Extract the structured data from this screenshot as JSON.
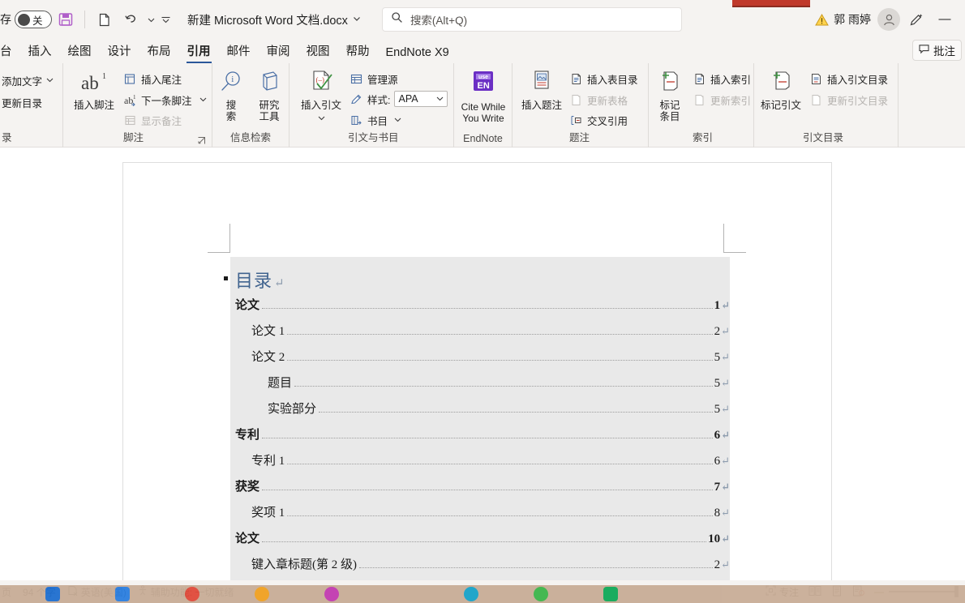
{
  "titlebar": {
    "autosave_label": "存",
    "toggle_state": "关",
    "save_icon": "save-icon",
    "new_icon": "new-document-icon",
    "undo_icon": "undo-icon",
    "customize_icon": "customize-quick-access-icon",
    "document_title": "新建 Microsoft Word 文档.docx",
    "title_chevron": "chevron-down-icon",
    "search_icon": "search-icon",
    "search_placeholder": "搜索(Alt+Q)",
    "warning_icon": "warning-icon",
    "user_name": "郭 雨婷",
    "avatar_icon": "account-avatar-icon",
    "pen_icon": "pen-annotate-icon",
    "minimize_label": "—"
  },
  "tabs": {
    "items": [
      {
        "label": "台",
        "active": false
      },
      {
        "label": "插入",
        "active": false
      },
      {
        "label": "绘图",
        "active": false
      },
      {
        "label": "设计",
        "active": false
      },
      {
        "label": "布局",
        "active": false
      },
      {
        "label": "引用",
        "active": true
      },
      {
        "label": "邮件",
        "active": false
      },
      {
        "label": "审阅",
        "active": false
      },
      {
        "label": "视图",
        "active": false
      },
      {
        "label": "帮助",
        "active": false
      },
      {
        "label": "EndNote X9",
        "active": false
      }
    ],
    "comments_label": "批注",
    "comments_icon": "comment-icon"
  },
  "ribbon": {
    "groups": [
      {
        "name": "toc",
        "label": "录",
        "items": [
          {
            "label": "添加文字",
            "icon": "add-text-icon",
            "chevron": true,
            "disabled": false
          },
          {
            "label": "更新目录",
            "icon": "update-toc-icon",
            "chevron": false,
            "disabled": false
          }
        ]
      },
      {
        "name": "footnotes",
        "label": "脚注",
        "big": {
          "label": "插入脚注",
          "icon": "ab-footnote-icon"
        },
        "items": [
          {
            "label": "插入尾注",
            "icon": "insert-endnote-icon",
            "chevron": false,
            "disabled": false
          },
          {
            "label": "下一条脚注",
            "icon": "next-footnote-icon",
            "chevron": true,
            "disabled": false
          },
          {
            "label": "显示备注",
            "icon": "show-notes-icon",
            "chevron": false,
            "disabled": true
          }
        ],
        "launcher": "dialog-launcher-icon"
      },
      {
        "name": "research",
        "label": "信息检索",
        "buttons": [
          {
            "label": "搜\n索",
            "line1": "搜",
            "line2": "索",
            "icon": "search-magnifier-icon"
          },
          {
            "label": "研究\n工具",
            "line1": "研究",
            "line2": "工具",
            "icon": "researcher-icon"
          }
        ]
      },
      {
        "name": "citations",
        "label": "引文与书目",
        "big": {
          "label": "插入引文",
          "icon": "insert-citation-icon",
          "chevron": true
        },
        "items": [
          {
            "label": "管理源",
            "icon": "manage-sources-icon",
            "chevron": false,
            "disabled": false
          },
          {
            "label": "样式:",
            "icon": "style-icon",
            "combo": "APA",
            "combo_chevron": "chevron-down-icon",
            "disabled": false
          },
          {
            "label": "书目",
            "icon": "bibliography-icon",
            "chevron": true,
            "disabled": false
          }
        ]
      },
      {
        "name": "endnote",
        "label": "EndNote",
        "big": {
          "line1": "Cite While",
          "line2": "You Write",
          "icon": "endnote-cwyw-icon",
          "icon_text_top": "use",
          "icon_text_bottom": "EN"
        }
      },
      {
        "name": "captions",
        "label": "题注",
        "big": {
          "label": "插入题注",
          "icon": "insert-caption-icon"
        },
        "items": [
          {
            "label": "插入表目录",
            "icon": "insert-table-of-figures-icon",
            "chevron": false,
            "disabled": false
          },
          {
            "label": "更新表格",
            "icon": "update-table-icon",
            "chevron": false,
            "disabled": true
          },
          {
            "label": "交叉引用",
            "icon": "cross-reference-icon",
            "chevron": false,
            "disabled": false
          }
        ]
      },
      {
        "name": "index",
        "label": "索引",
        "big": {
          "line1": "标记",
          "line2": "条目",
          "icon": "mark-entry-icon"
        },
        "items": [
          {
            "label": "插入索引",
            "icon": "insert-index-icon",
            "chevron": false,
            "disabled": false
          },
          {
            "label": "更新索引",
            "icon": "update-index-icon",
            "chevron": false,
            "disabled": true
          }
        ]
      },
      {
        "name": "authorities",
        "label": "引文目录",
        "big": {
          "label": "标记引文",
          "icon": "mark-citation-icon"
        },
        "items": [
          {
            "label": "插入引文目录",
            "icon": "insert-table-of-authorities-icon",
            "chevron": false,
            "disabled": false
          },
          {
            "label": "更新引文目录",
            "icon": "update-table-of-authorities-icon",
            "chevron": false,
            "disabled": true
          }
        ]
      }
    ]
  },
  "document": {
    "toc_heading": "目录",
    "pilcrow": "↵",
    "entries": [
      {
        "text": "论文",
        "page": "1",
        "level": 1
      },
      {
        "text": "论文 1",
        "page": "2",
        "level": 2
      },
      {
        "text": "论文 2",
        "page": "5",
        "level": 2
      },
      {
        "text": "题目",
        "page": "5",
        "level": 3
      },
      {
        "text": "实验部分",
        "page": "5",
        "level": 3
      },
      {
        "text": "专利",
        "page": "6",
        "level": 1
      },
      {
        "text": "专利 1",
        "page": "6",
        "level": 2
      },
      {
        "text": "获奖",
        "page": "7",
        "level": 1
      },
      {
        "text": "奖项 1",
        "page": "8",
        "level": 2
      },
      {
        "text": "论文",
        "page": "10",
        "level": 1
      },
      {
        "text": "键入章标题(第 2 级)",
        "page": "2",
        "level": 2
      }
    ]
  },
  "statusbar": {
    "page_label": "页",
    "word_count": "94 个字",
    "proofing_icon": "proofing-errors-icon",
    "language": "英语(美国)",
    "accessibility_icon": "accessibility-icon",
    "accessibility": "辅助功能: 一切就绪",
    "focus_icon": "focus-mode-icon",
    "focus_label": "专注",
    "read_mode_icon": "read-mode-icon",
    "print_layout_icon": "print-layout-icon",
    "web_layout_icon": "web-layout-icon",
    "zoom_out": "—",
    "zoom_in": "+"
  },
  "colors": {
    "accent": "#2b579a",
    "ribbon_bg": "#f5f3f1",
    "selection": "#e9e9e9",
    "heading_blue": "#41648f",
    "red_flag": "#c0392b",
    "taskbar": "#c8ad97"
  }
}
